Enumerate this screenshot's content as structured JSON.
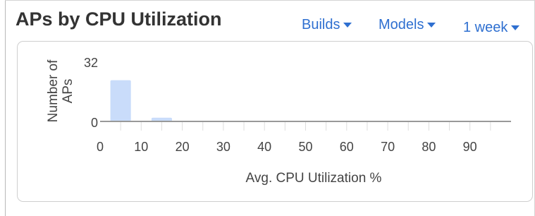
{
  "widget": {
    "title": "APs by CPU Utilization",
    "filters": {
      "builds": "Builds",
      "models": "Models",
      "period": "1 week"
    },
    "accent_color": "#2e6fd0"
  },
  "chart_data": {
    "type": "bar",
    "title": "",
    "xlabel": "Avg. CPU Utilization %",
    "ylabel": "Number of APs",
    "x_ticks": [
      0,
      10,
      20,
      30,
      40,
      50,
      60,
      70,
      80,
      90
    ],
    "y_ticks": [
      0,
      32
    ],
    "xlim": [
      0,
      100
    ],
    "ylim": [
      0,
      32
    ],
    "bin_width": 5,
    "bins": [
      {
        "start": 2.5,
        "end": 7.5,
        "value": 22
      },
      {
        "start": 12.5,
        "end": 17.5,
        "value": 2
      }
    ],
    "bar_color": "#c9dcfa",
    "grid": "vertical",
    "legend": "none"
  }
}
